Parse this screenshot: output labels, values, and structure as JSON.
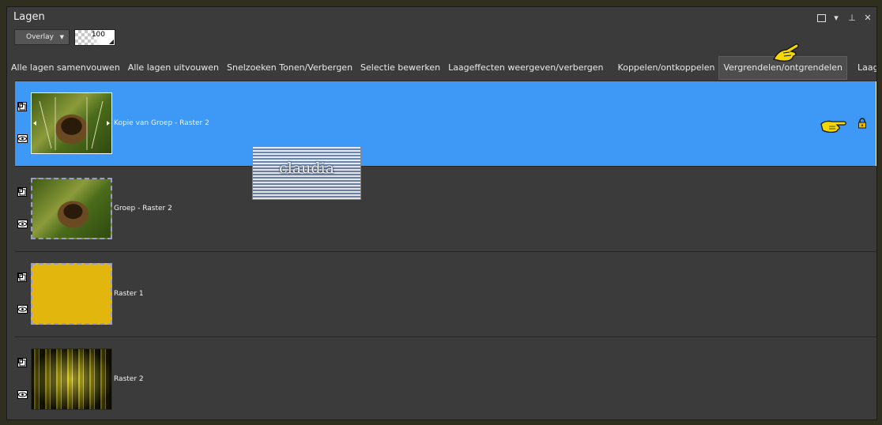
{
  "panel": {
    "title": "Lagen",
    "blend_mode": "Overlay",
    "opacity_value": "100"
  },
  "window_icons": [
    "maximize-icon",
    "dropdown-icon",
    "pin-icon",
    "close-icon"
  ],
  "toolbar": {
    "buttons": [
      {
        "label": "Alle lagen samenvouwen"
      },
      {
        "label": "Alle lagen uitvouwen"
      },
      {
        "label": "Snelzoeken Tonen/Verbergen"
      },
      {
        "label": "Selectie bewerken"
      },
      {
        "label": "Laageffecten weergeven/verbergen"
      },
      {
        "label": "Koppelen/ontkoppelen"
      },
      {
        "label": "Vergrendelen/ontgrendelen"
      },
      {
        "label": "Laagstijlen"
      }
    ],
    "active_index": 6
  },
  "layers": [
    {
      "name": "Kopie van Groep - Raster 2",
      "selected": true,
      "locked": true
    },
    {
      "name": "Groep - Raster 2",
      "selected": false,
      "locked": false
    },
    {
      "name": "Raster 1",
      "selected": false,
      "locked": false
    },
    {
      "name": "Raster 2",
      "selected": false,
      "locked": false
    }
  ],
  "watermark": {
    "text": "claudia"
  },
  "colors": {
    "selection_blue": "#3d98f6",
    "panel_bg": "#3b3b3b",
    "raster1_yellow": "#e2b60c",
    "pointer_yellow": "#f5d800"
  }
}
